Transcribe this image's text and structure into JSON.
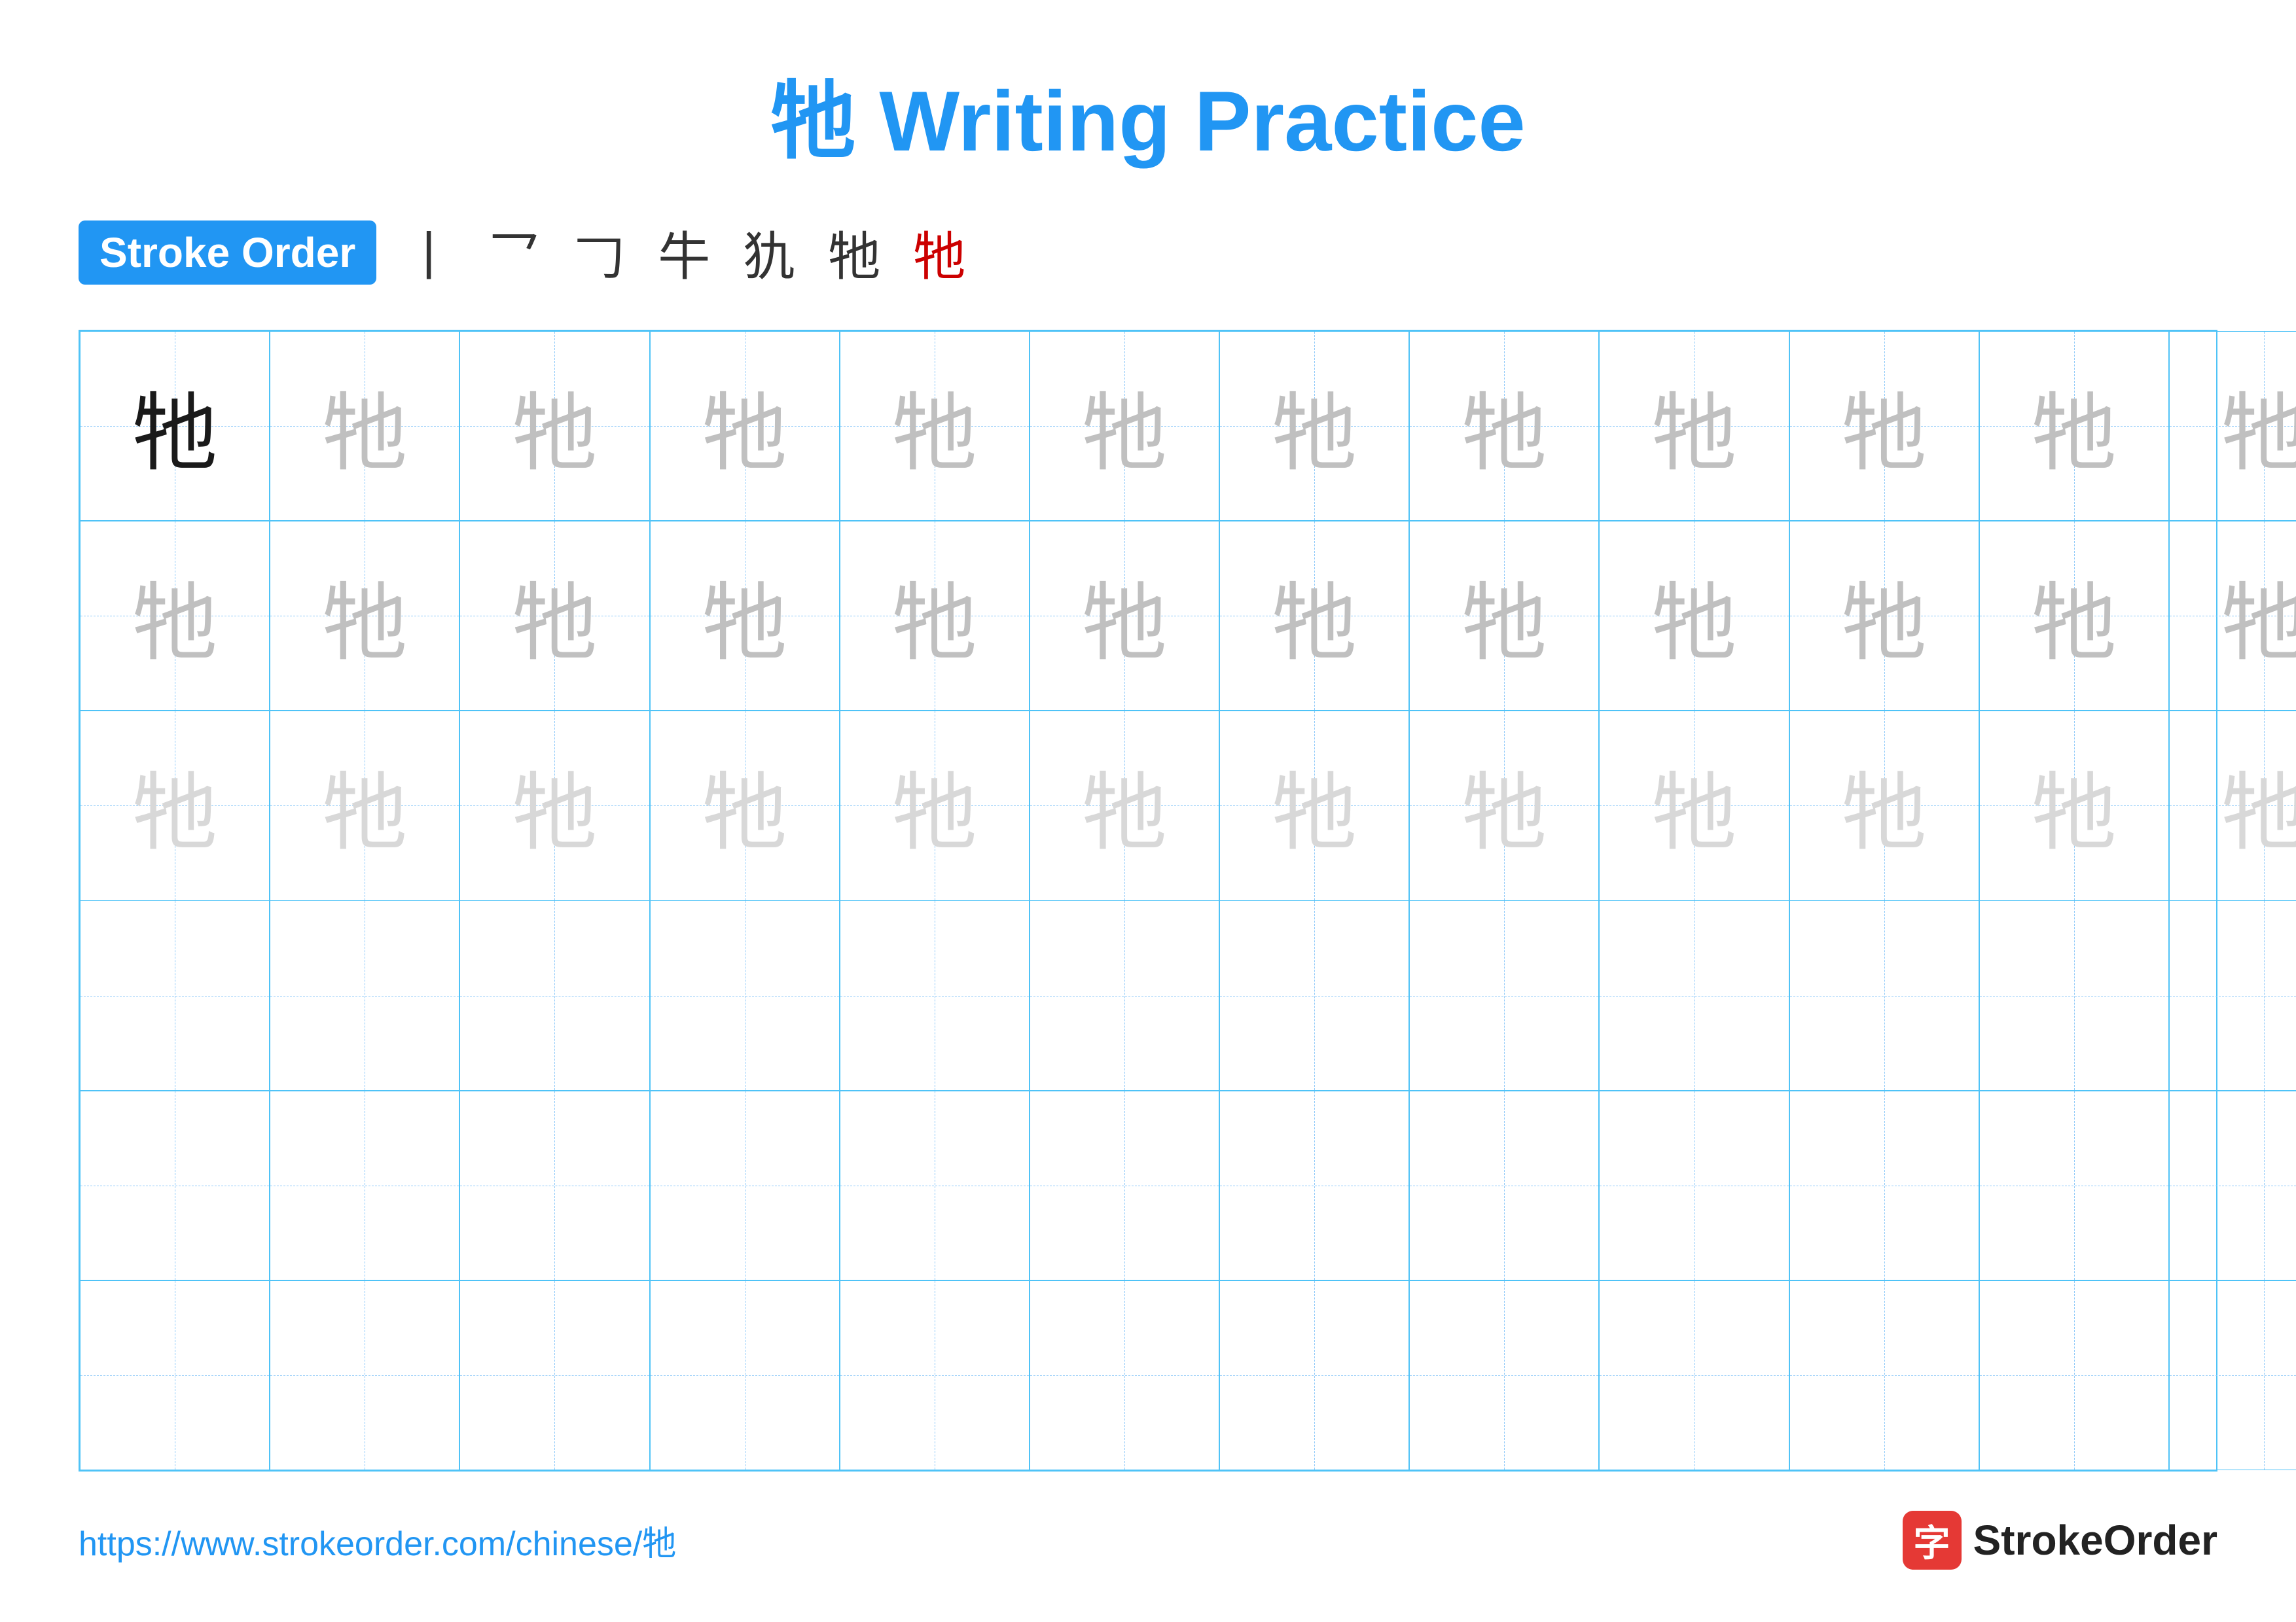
{
  "title": "牠 Writing Practice",
  "stroke_order": {
    "badge_label": "Stroke Order",
    "steps": [
      "丨",
      "⺂",
      "乛",
      "牛",
      "牜",
      "牠",
      "牠"
    ]
  },
  "character": "牠",
  "grid": {
    "cols": 13,
    "rows": 6
  },
  "footer": {
    "url": "https://www.strokeorder.com/chinese/牠",
    "logo_icon": "字",
    "logo_text": "StrokeOrder"
  }
}
